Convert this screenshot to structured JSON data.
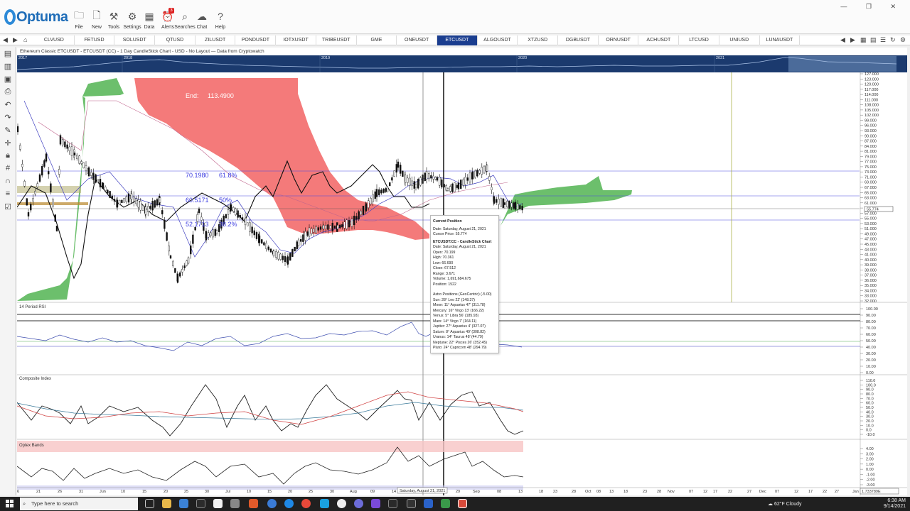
{
  "app": {
    "name": "Optuma"
  },
  "ribbon": {
    "buttons": [
      {
        "label": "File",
        "icon": "folder-icon"
      },
      {
        "label": "New",
        "icon": "new-file-icon"
      },
      {
        "label": "Tools",
        "icon": "tools-icon"
      },
      {
        "label": "Settings",
        "icon": "gear-icon"
      },
      {
        "label": "Data",
        "icon": "data-icon"
      },
      {
        "label": "Alerts",
        "icon": "alarm-icon",
        "badge": "3"
      },
      {
        "label": "Searches",
        "icon": "search-icon"
      },
      {
        "label": "Chat",
        "icon": "chat-icon"
      },
      {
        "label": "Help",
        "icon": "help-icon"
      }
    ]
  },
  "tabs": [
    "CLVUSD",
    "FETUSD",
    "SOLUSDT",
    "QTUSD",
    "ZILUSDT",
    "PONDUSDT",
    "IOTXUSDT",
    "TRIBEUSDT",
    "GME",
    "ONEUSDT",
    "ETCUSDT",
    "ALGOUSDT",
    "XTZUSD",
    "DGBUSDT",
    "ORNUSDT",
    "ACHUSDT",
    "LTCUSD",
    "UNIUSD",
    "LUNAUSDT"
  ],
  "active_tab": "ETCUSDT",
  "chart_title": "Ethereum Classic ETCUSDT - ETCUSDT (CC) - 1 Day CandleStick Chart - USD - No Layout — Data from Cryptowatch",
  "overview_years": [
    "2017",
    "2018",
    "2019",
    "2020",
    "2021"
  ],
  "annotations": {
    "end_label": "End:",
    "end_value": "113.4900",
    "fib": [
      {
        "price": "70.1980",
        "pct": "61.8%"
      },
      {
        "price": "60.5171",
        "pct": "50%"
      },
      {
        "price": "52.1713",
        "pct": "38.2%"
      }
    ]
  },
  "price_axis": [
    "127.000",
    "123.000",
    "120.000",
    "117.000",
    "114.000",
    "111.000",
    "108.000",
    "105.000",
    "102.000",
    "99.000",
    "96.000",
    "93.000",
    "90.000",
    "87.000",
    "84.000",
    "81.000",
    "79.000",
    "77.000",
    "75.000",
    "73.000",
    "71.000",
    "69.000",
    "67.000",
    "65.000",
    "63.000",
    "61.000",
    "59.000",
    "57.000",
    "55.000",
    "53.000",
    "51.000",
    "49.000",
    "47.000",
    "45.000",
    "43.000",
    "41.000",
    "40.000",
    "39.000",
    "38.000",
    "37.000",
    "36.000",
    "35.000",
    "34.000",
    "33.000",
    "32.000"
  ],
  "price_marker": "55.774",
  "panels": {
    "rsi": {
      "title": "14 Period RSI",
      "axis": [
        "100.00",
        "90.00",
        "80.00",
        "70.00",
        "60.00",
        "50.00",
        "40.00",
        "30.00",
        "20.00",
        "10.00",
        "0.00"
      ]
    },
    "composite": {
      "title": "Composite Index",
      "axis": [
        "110.0",
        "100.0",
        "90.0",
        "80.0",
        "70.0",
        "60.0",
        "50.0",
        "40.0",
        "30.0",
        "20.0",
        "10.0",
        "0.0",
        "-10.0"
      ]
    },
    "optex": {
      "title": "Optex Bands",
      "axis": [
        "4.00",
        "3.00",
        "2.00",
        "1.00",
        "0.00",
        "-1.00",
        "-2.00",
        "-3.00"
      ]
    }
  },
  "date_axis": [
    "6",
    "21",
    "26",
    "31",
    "Jun",
    "10",
    "15",
    "20",
    "25",
    "30",
    "Jul",
    "10",
    "15",
    "20",
    "25",
    "30",
    "Aug",
    "09",
    "14",
    "29",
    "Sep",
    "08",
    "13",
    "18",
    "23",
    "28",
    "Oct",
    "08",
    "13",
    "18",
    "23",
    "28",
    "Nov",
    "07",
    "12",
    "17",
    "22",
    "27",
    "Dec",
    "07",
    "12",
    "17",
    "22",
    "27",
    "Jan"
  ],
  "date_cursor_label": "Saturday, August 21, 2021",
  "cursor_value_label": "1.733789E",
  "tooltip": {
    "cp_title": "Current Position",
    "cp_date": "Date: Saturday, August 21, 2021",
    "cp_price": "Cursor Price: 55.774",
    "cs_title": "ETCUSDT:CC - CandleStick Chart",
    "cs_lines": [
      "Date: Saturday, August 21, 2021",
      "Open: 70.199",
      "High: 70.361",
      "Low: 66.690",
      "Close: 67.512",
      "Range: 3.671",
      "Volume: 1,691,684.675",
      "Position: 1522"
    ],
    "astro_title": "Astro Positions (GeoCentric) (-5.00)",
    "astro_lines": [
      "Sun: 28° Leo 22' (148.37)",
      "Moon: 11° Aquarius 47' (311.78)",
      "Mercury: 16° Virgo 13' (166.22)",
      "Venus: 5° Libra 56' (185.93)",
      "Mars: 14° Virgo 7' (164.11)",
      "Jupiter: 27° Aquarius 4' (327.07)",
      "Saturn: 8° Aquarius 49' (308.82)",
      "Uranus: 14° Taurus 48' (44.79)",
      "Neptune: 22° Pisces 26' (352.45)",
      "Pluto: 24° Capricorn 48' (294.79)"
    ]
  },
  "taskbar": {
    "search_placeholder": "Type here to search",
    "weather": "62°F  Cloudy",
    "time": "6:38 AM",
    "date": "9/14/2021"
  }
}
